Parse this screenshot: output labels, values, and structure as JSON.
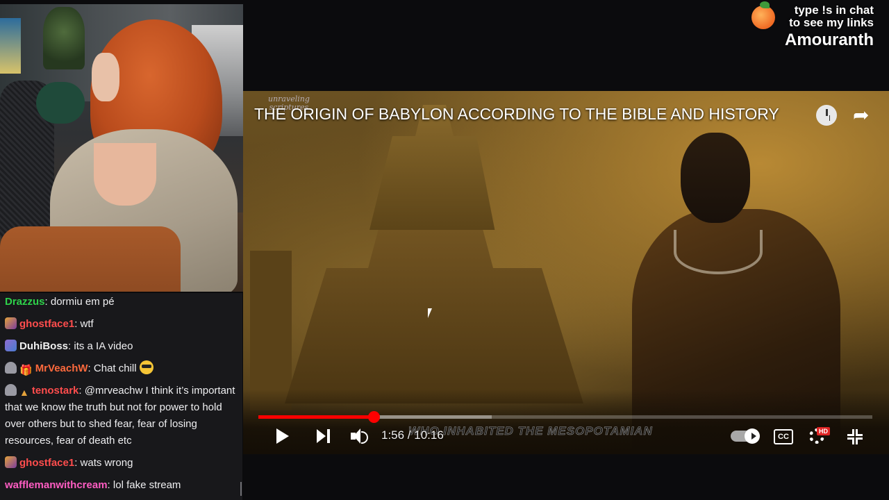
{
  "overlay": {
    "line1": "type !s in chat",
    "line2": "to see my links",
    "brand": "Amouranth",
    "icon": "peach-icon"
  },
  "video": {
    "channel_logo_line1": "unraveling",
    "channel_logo_line2": "scriptures",
    "title": "THE ORIGIN OF BABYLON ACCORDING TO THE BIBLE AND HISTORY",
    "time_display": "1:56 / 10:16",
    "caption": "WHO INHABITED THE MESOPOTAMIAN",
    "progress_fraction": 0.188,
    "buffered_fraction": 0.38,
    "cc_label": "CC",
    "hd_badge": "HD",
    "icons": [
      "clock-icon",
      "share-icon",
      "play-icon",
      "next-icon",
      "volume-icon",
      "autoplay-toggle",
      "cc-icon",
      "settings-icon",
      "exit-fullscreen-icon"
    ]
  },
  "chat": {
    "messages": [
      {
        "user": "Drazzus",
        "color": "#2ed24a",
        "text": "dormiu em pé"
      },
      {
        "user": "ghostface1",
        "color": "#ff4d4d",
        "text": "wtf"
      },
      {
        "user": "DuhiBoss",
        "color": "#f0f0f0",
        "text": "its a IA video"
      },
      {
        "user": "MrVeachW",
        "color": "#ff6a3d",
        "text": "Chat chill"
      },
      {
        "user": "tenostark",
        "color": "#ff4d4d",
        "text": "@mrveachw I think it’s important that we know the truth but not for power to hold over others but to shed fear, fear of losing resources, fear of death etc"
      },
      {
        "user": "ghostface1",
        "color": "#ff4d4d",
        "text": "wats wrong"
      },
      {
        "user": "wafflemanwithcream",
        "color": "#ff5dc3",
        "text": "lol fake stream"
      }
    ]
  }
}
